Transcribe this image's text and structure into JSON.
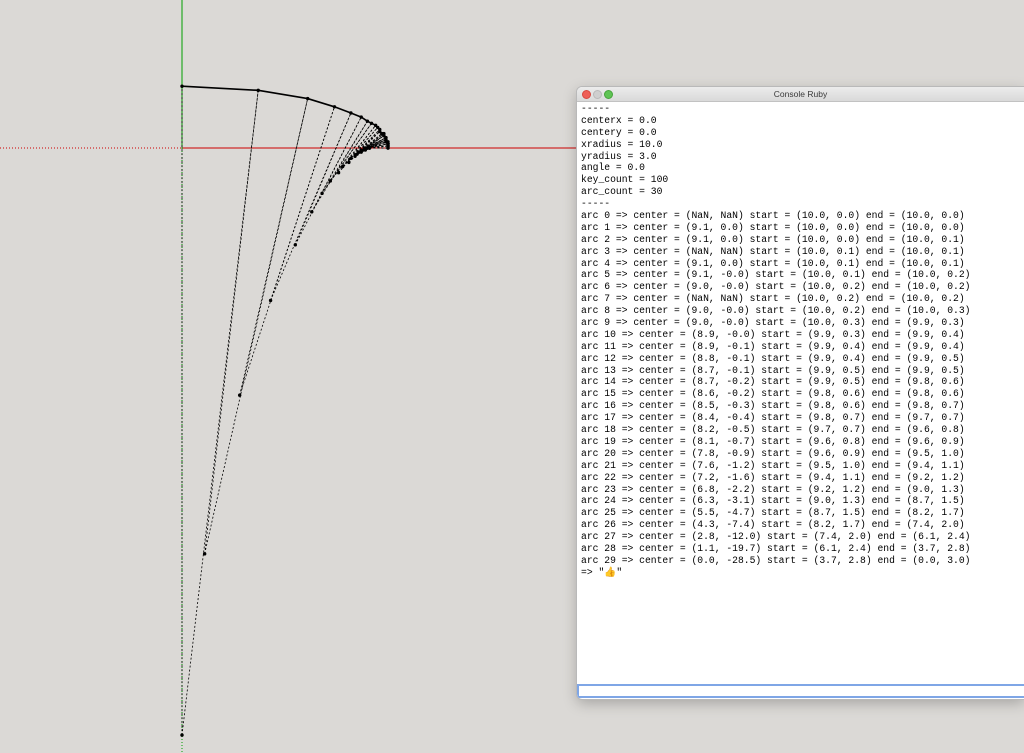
{
  "console": {
    "title": "Console Ruby",
    "lines": [
      "-----",
      "centerx = 0.0",
      "centery = 0.0",
      "xradius = 10.0",
      "yradius = 3.0",
      "angle = 0.0",
      "key_count = 100",
      "arc_count = 30",
      "-----",
      "arc 0 => center = (NaN, NaN) start = (10.0, 0.0) end = (10.0, 0.0)",
      "arc 1 => center = (9.1, 0.0) start = (10.0, 0.0) end = (10.0, 0.0)",
      "arc 2 => center = (9.1, 0.0) start = (10.0, 0.0) end = (10.0, 0.1)",
      "arc 3 => center = (NaN, NaN) start = (10.0, 0.1) end = (10.0, 0.1)",
      "arc 4 => center = (9.1, 0.0) start = (10.0, 0.1) end = (10.0, 0.1)",
      "arc 5 => center = (9.1, -0.0) start = (10.0, 0.1) end = (10.0, 0.2)",
      "arc 6 => center = (9.0, -0.0) start = (10.0, 0.2) end = (10.0, 0.2)",
      "arc 7 => center = (NaN, NaN) start = (10.0, 0.2) end = (10.0, 0.2)",
      "arc 8 => center = (9.0, -0.0) start = (10.0, 0.2) end = (10.0, 0.3)",
      "arc 9 => center = (9.0, -0.0) start = (10.0, 0.3) end = (9.9, 0.3)",
      "arc 10 => center = (8.9, -0.0) start = (9.9, 0.3) end = (9.9, 0.4)",
      "arc 11 => center = (8.9, -0.1) start = (9.9, 0.4) end = (9.9, 0.4)",
      "arc 12 => center = (8.8, -0.1) start = (9.9, 0.4) end = (9.9, 0.5)",
      "arc 13 => center = (8.7, -0.1) start = (9.9, 0.5) end = (9.9, 0.5)",
      "arc 14 => center = (8.7, -0.2) start = (9.9, 0.5) end = (9.8, 0.6)",
      "arc 15 => center = (8.6, -0.2) start = (9.8, 0.6) end = (9.8, 0.6)",
      "arc 16 => center = (8.5, -0.3) start = (9.8, 0.6) end = (9.8, 0.7)",
      "arc 17 => center = (8.4, -0.4) start = (9.8, 0.7) end = (9.7, 0.7)",
      "arc 18 => center = (8.2, -0.5) start = (9.7, 0.7) end = (9.6, 0.8)",
      "arc 19 => center = (8.1, -0.7) start = (9.6, 0.8) end = (9.6, 0.9)",
      "arc 20 => center = (7.8, -0.9) start = (9.6, 0.9) end = (9.5, 1.0)",
      "arc 21 => center = (7.6, -1.2) start = (9.5, 1.0) end = (9.4, 1.1)",
      "arc 22 => center = (7.2, -1.6) start = (9.4, 1.1) end = (9.2, 1.2)",
      "arc 23 => center = (6.8, -2.2) start = (9.2, 1.2) end = (9.0, 1.3)",
      "arc 24 => center = (6.3, -3.1) start = (9.0, 1.3) end = (8.7, 1.5)",
      "arc 25 => center = (5.5, -4.7) start = (8.7, 1.5) end = (8.2, 1.7)",
      "arc 26 => center = (4.3, -7.4) start = (8.2, 1.7) end = (7.4, 2.0)",
      "arc 27 => center = (2.8, -12.0) start = (7.4, 2.0) end = (6.1, 2.4)",
      "arc 28 => center = (1.1, -19.7) start = (6.1, 2.4) end = (3.7, 2.8)",
      "arc 29 => center = (0.0, -28.5) start = (3.7, 2.8) end = (0.0, 3.0)",
      "=> \"👍\""
    ],
    "input_value": ""
  },
  "colors": {
    "canvas_bg": "#dbd9d6",
    "x_axis": "#cc0000",
    "y_axis": "#00a000",
    "geometry": "#000000",
    "input_focus": "#7fa6e6"
  }
}
